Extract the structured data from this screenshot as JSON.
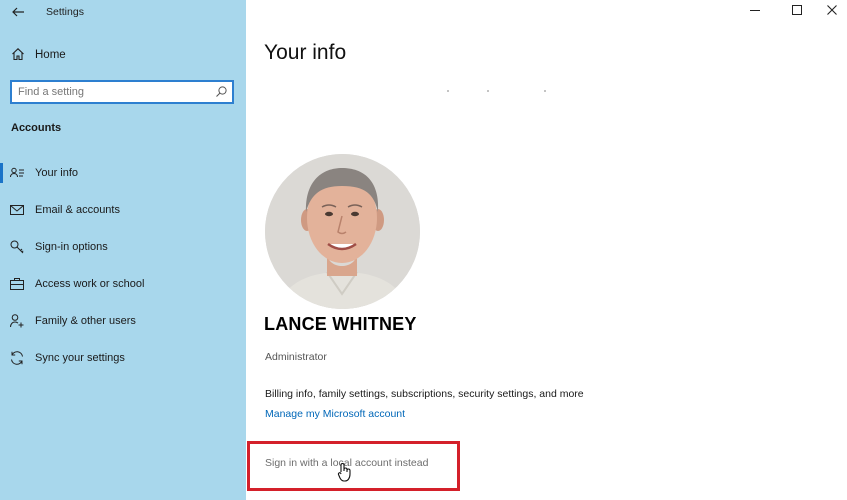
{
  "window": {
    "app_title": "Settings",
    "controls": [
      "minimize-icon",
      "maximize-icon",
      "close-icon"
    ]
  },
  "sidebar": {
    "home_label": "Home",
    "search": {
      "placeholder": "Find a setting",
      "value": ""
    },
    "section_heading": "Accounts",
    "items": [
      {
        "label": "Your info",
        "icon": "person-card-icon",
        "active": true
      },
      {
        "label": "Email & accounts",
        "icon": "mail-icon",
        "active": false
      },
      {
        "label": "Sign-in options",
        "icon": "key-icon",
        "active": false
      },
      {
        "label": "Access work or school",
        "icon": "briefcase-icon",
        "active": false
      },
      {
        "label": "Family & other users",
        "icon": "person-add-icon",
        "active": false
      },
      {
        "label": "Sync your settings",
        "icon": "sync-icon",
        "active": false
      }
    ]
  },
  "main": {
    "title": "Your info",
    "user_name": "LANCE WHITNEY",
    "role": "Administrator",
    "billing_text": "Billing info, family settings, subscriptions, security settings, and more",
    "manage_link": "Manage my Microsoft account",
    "local_account_link": "Sign in with a local account instead"
  },
  "colors": {
    "sidebar_bg": "#a8d7ec",
    "accent": "#0067b8",
    "highlight_box": "#d4202a"
  }
}
